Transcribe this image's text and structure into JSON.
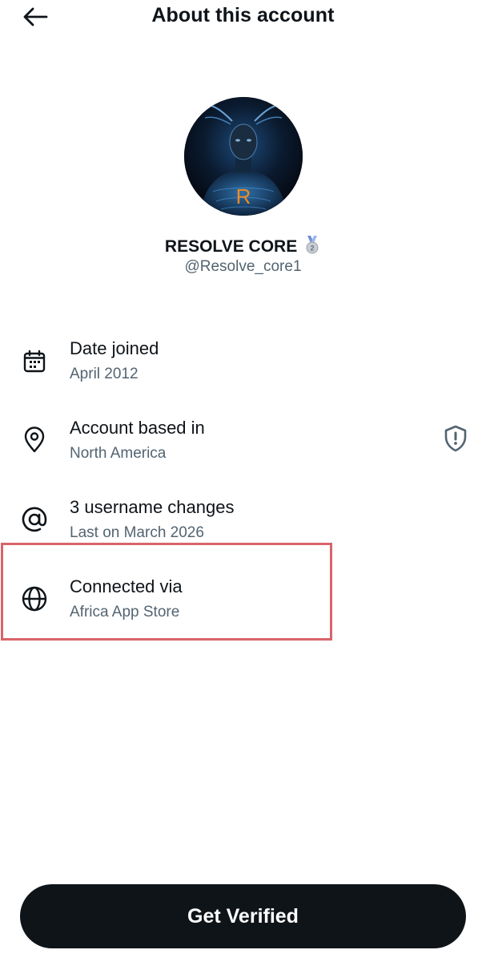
{
  "header": {
    "title": "About this account",
    "back_icon": "arrow-left-icon"
  },
  "profile": {
    "display_name": "RESOLVE CORE",
    "badge_icon": "second-place-medal-icon",
    "handle": "@Resolve_core1",
    "avatar_monogram": "R",
    "avatar_accent_color": "#f08a24"
  },
  "details": [
    {
      "icon": "calendar-icon",
      "title": "Date joined",
      "value": "April 2012"
    },
    {
      "icon": "location-pin-icon",
      "title": "Account based in",
      "value": "North America",
      "action_icon": "shield-alert-icon"
    },
    {
      "icon": "at-sign-icon",
      "title": "3 username changes",
      "value": "Last on March 2026"
    },
    {
      "icon": "globe-icon",
      "title": "Connected via",
      "value": "Africa App Store"
    }
  ],
  "annotation": {
    "highlight_color": "#d9646a"
  },
  "cta": {
    "label": "Get Verified",
    "background": "#0f1419"
  },
  "colors": {
    "primary_text": "#0f1419",
    "secondary_text": "#536471"
  }
}
